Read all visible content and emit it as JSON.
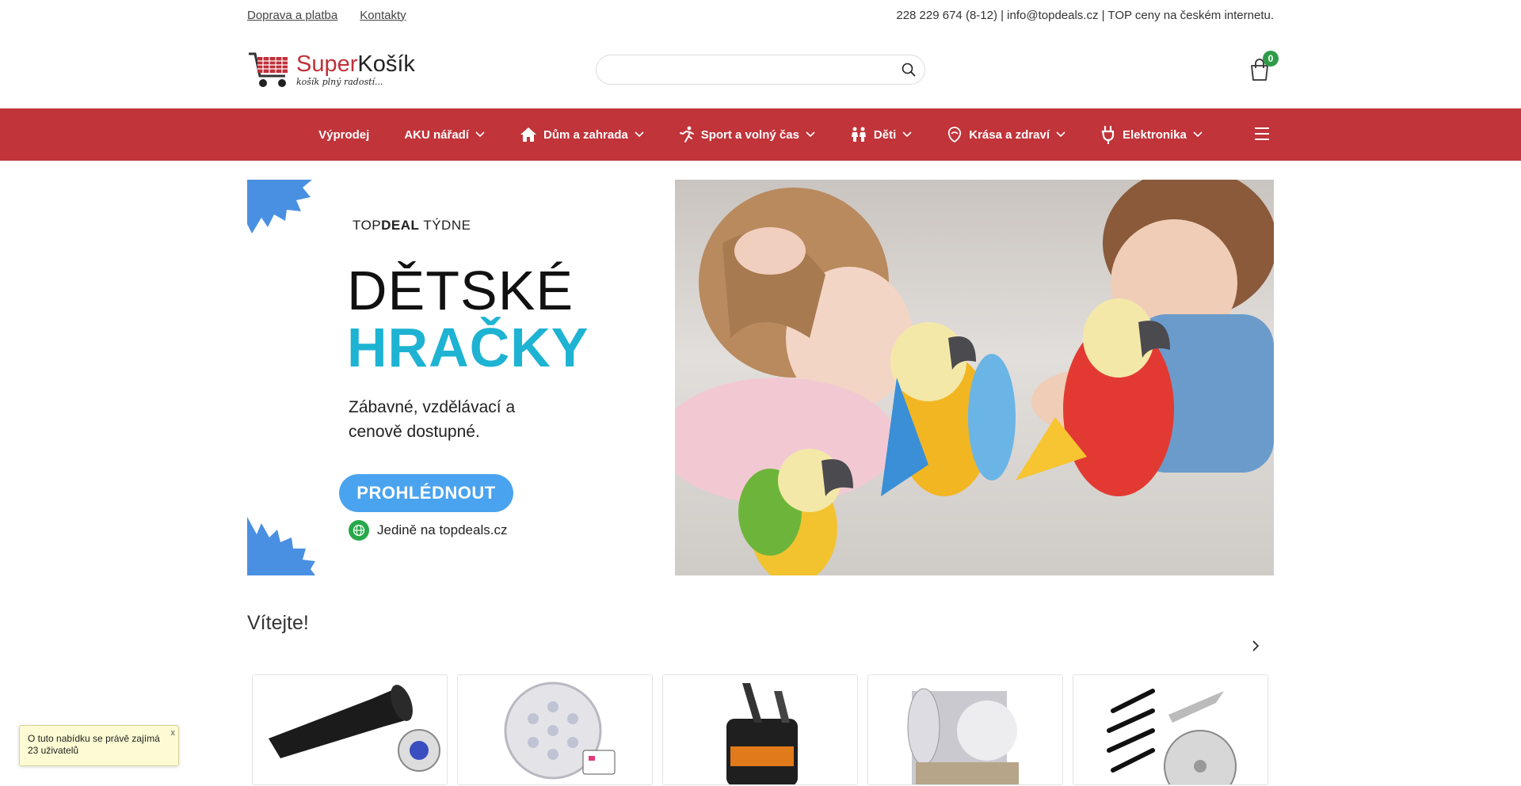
{
  "topbar": {
    "links": [
      "Doprava a platba",
      "Kontakty"
    ],
    "contact": "228 229 674 (8-12) | info@topdeals.cz | TOP ceny na českém internetu."
  },
  "header": {
    "logo_super": "Super",
    "logo_kosik": "Košík",
    "logo_tagline": "košík plný radostí...",
    "search_placeholder": "",
    "cart_count": "0"
  },
  "nav": {
    "items": [
      {
        "label": "Výprodej",
        "icon": "",
        "dropdown": false
      },
      {
        "label": "AKU nářadí",
        "icon": "",
        "dropdown": true
      },
      {
        "label": "Dům a zahrada",
        "icon": "house-icon",
        "dropdown": true
      },
      {
        "label": "Sport a volný čas",
        "icon": "runner-icon",
        "dropdown": true
      },
      {
        "label": "Děti",
        "icon": "children-icon",
        "dropdown": true
      },
      {
        "label": "Krása a zdraví",
        "icon": "beauty-icon",
        "dropdown": true
      },
      {
        "label": "Elektronika",
        "icon": "plug-icon",
        "dropdown": true
      }
    ],
    "menu_icon": "hamburger-icon"
  },
  "banner": {
    "kicker_top": "TOP",
    "kicker_deal": "DEAL",
    "kicker_week": " TÝDNE",
    "title_line1": "DĚTSKÉ",
    "title_line2": "HRAČKY",
    "subtitle": "Zábavné, vzdělávací a cenově dostupné.",
    "cta": "PROHLÉDNOUT",
    "only": "Jedině na topdeals.cz"
  },
  "welcome": "Vítejte!",
  "products": [
    {
      "name": "flashlight"
    },
    {
      "name": "led-light"
    },
    {
      "name": "chainsaw"
    },
    {
      "name": "insulation-foil"
    },
    {
      "name": "trimmer-blades"
    }
  ],
  "toast": {
    "text": "O tuto nabídku se právě zajímá 23 uživatelů",
    "close": "x"
  },
  "colors": {
    "brand_red": "#c0343a",
    "badge_green": "#2e9b48",
    "accent_blue": "#4aa3ee",
    "title_cyan": "#1eb3d3"
  }
}
